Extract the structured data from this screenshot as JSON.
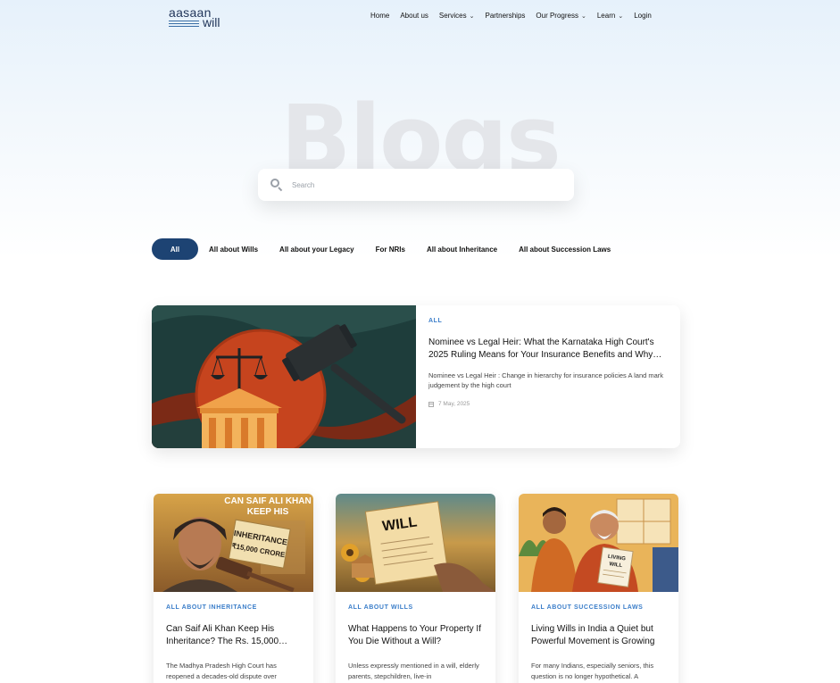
{
  "header": {
    "logo_top": "aasaan",
    "logo_bottom": "will",
    "nav": [
      {
        "label": "Home",
        "has_dropdown": false
      },
      {
        "label": "About us",
        "has_dropdown": false
      },
      {
        "label": "Services",
        "has_dropdown": true
      },
      {
        "label": "Partnerships",
        "has_dropdown": false
      },
      {
        "label": "Our Progress",
        "has_dropdown": true
      },
      {
        "label": "Learn",
        "has_dropdown": true
      },
      {
        "label": "Login",
        "has_dropdown": false
      }
    ]
  },
  "hero": {
    "title": "Blogs",
    "search_placeholder": "Search",
    "search_value": ""
  },
  "filters": {
    "active": "All",
    "items": [
      "All",
      "All about Wills",
      "All about your Legacy",
      "For NRIs",
      "All about Inheritance",
      "All about Succession Laws"
    ]
  },
  "featured": {
    "category": "ALL",
    "title": "Nominee vs Legal Heir: What the Karnataka High Court's 2025 Ruling Means for Your Insurance Benefits and Why…",
    "excerpt": "Nominee vs Legal Heir : Change in hierarchy for insurance policies A land mark judgement by the high court",
    "date": "7 May, 2025",
    "image_icon": "gavel-scales-court-illustration"
  },
  "cards": [
    {
      "category": "ALL ABOUT INHERITANCE",
      "title": "Can Saif Ali Khan Keep His Inheritance? The Rs. 15,000…",
      "excerpt": "The Madhya Pradesh High Court has reopened a decades-old dispute over",
      "image_icon": "inheritance-gavel-illustration",
      "image_text": {
        "headline_1": "CAN SAIF ALI KHAN",
        "headline_2": "KEEP HIS",
        "sign_1": "INHERITANCE",
        "sign_2": "₹15,000 CRORE"
      }
    },
    {
      "category": "ALL ABOUT WILLS",
      "title": "What Happens to Your Property If You Die Without a Will?",
      "excerpt": "Unless expressly mentioned in a will, elderly parents, stepchildren, live-in",
      "image_icon": "will-document-illustration",
      "image_text": {
        "paper": "WILL"
      }
    },
    {
      "category": "ALL ABOUT SUCCESSION LAWS",
      "title": "Living Wills in India a Quiet but Powerful Movement is Growing",
      "excerpt": "For many Indians, especially seniors, this question is no longer hypothetical. A",
      "image_icon": "living-will-illustration",
      "image_text": {
        "paper_1": "LIVING",
        "paper_2": "WILL"
      }
    }
  ],
  "colors": {
    "accent": "#1d4373",
    "category": "#3a7dc9"
  }
}
